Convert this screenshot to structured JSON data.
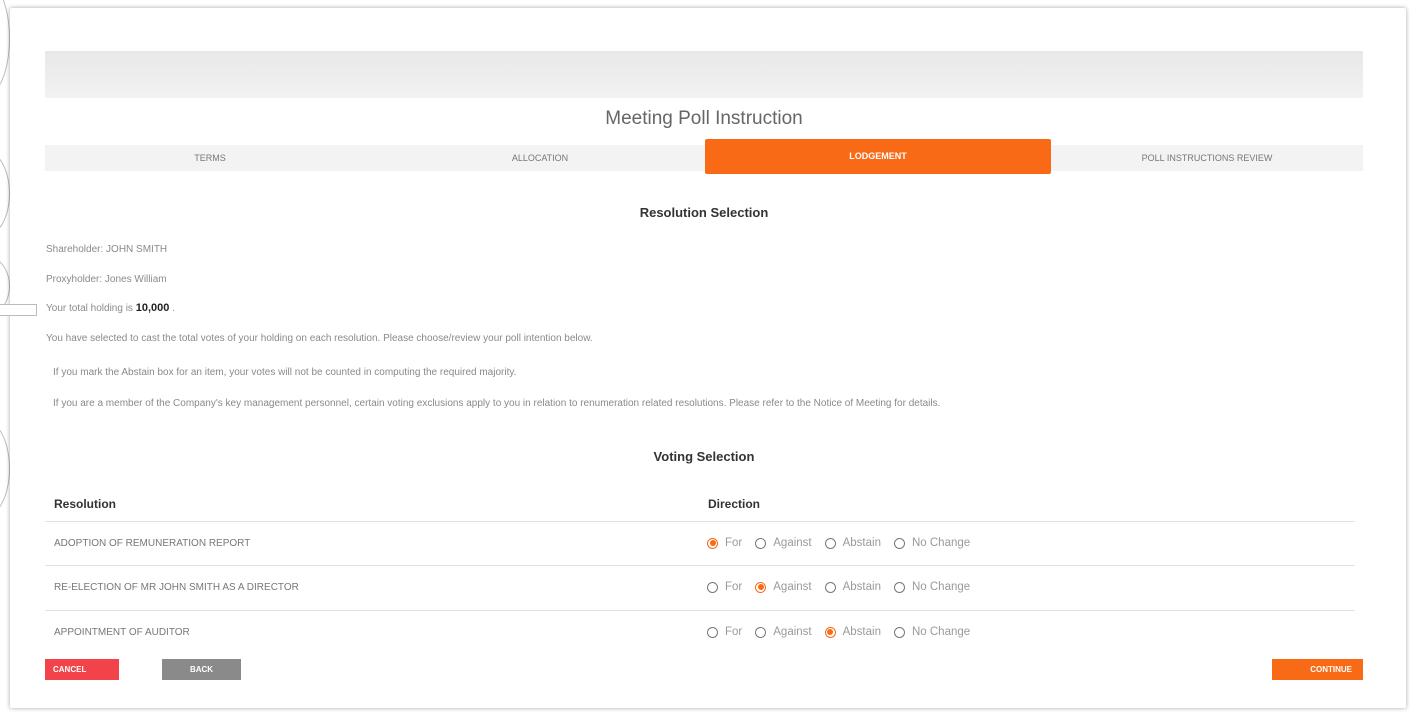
{
  "page": {
    "title": "Meeting Poll Instruction"
  },
  "steps": [
    {
      "label": "TERMS",
      "active": false
    },
    {
      "label": "ALLOCATION",
      "active": false
    },
    {
      "label": "LODGEMENT",
      "active": true
    },
    {
      "label": "POLL INSTRUCTIONS REVIEW",
      "active": false
    }
  ],
  "resolution_selection": {
    "heading": "Resolution Selection",
    "shareholder": "Shareholder: JOHN SMITH",
    "proxyholder": "Proxyholder: Jones William",
    "holding_prefix": "Your total holding is ",
    "holding_value": "10,000",
    "holding_suffix": " .",
    "notice_1": "You have selected to cast the total votes of your holding on each resolution. Please choose/review your poll intention below.",
    "notice_2": "If you mark the Abstain box for an item, your votes will not be counted in computing the required majority.",
    "notice_3": "If you are a member of the Company's key management personnel, certain voting exclusions apply to you in relation to renumeration related resolutions. Please refer to the Notice of Meeting for details."
  },
  "voting": {
    "heading": "Voting Selection",
    "col_resolution": "Resolution",
    "col_direction": "Direction",
    "options": [
      "For",
      "Against",
      "Abstain",
      "No Change"
    ],
    "rows": [
      {
        "label": "ADOPTION OF REMUNERATION REPORT",
        "selected": "For"
      },
      {
        "label": "RE-ELECTION OF MR JOHN SMITH AS A DIRECTOR",
        "selected": "Against"
      },
      {
        "label": "APPOINTMENT OF AUDITOR",
        "selected": "Abstain"
      }
    ]
  },
  "buttons": {
    "cancel": "CANCEL",
    "back": "BACK",
    "continue": "CONTINUE"
  },
  "colors": {
    "accent": "#f96a16",
    "cancel": "#f2434a",
    "back": "#8a8a8a"
  }
}
